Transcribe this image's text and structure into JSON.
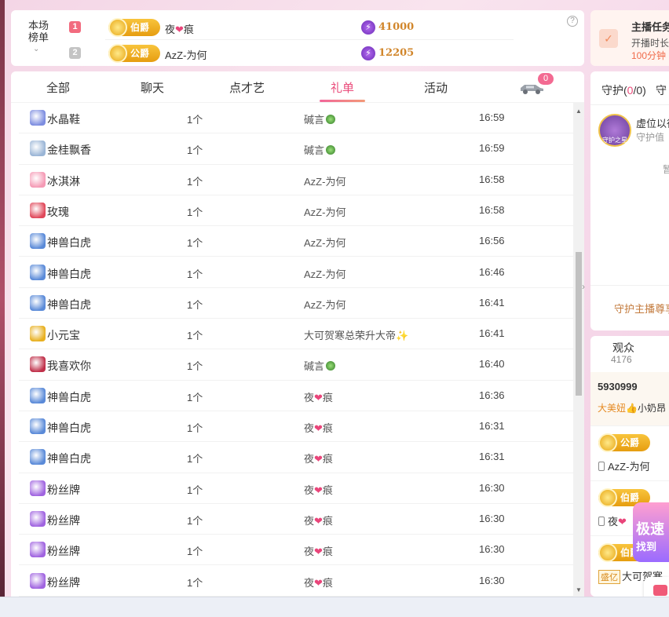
{
  "rank": {
    "title": "本场榜单",
    "help": "?",
    "rows": [
      {
        "num": "1",
        "badge": "伯爵",
        "name_a": "夜",
        "name_b": "痕",
        "value": "41000"
      },
      {
        "num": "2",
        "badge": "公爵",
        "name_a": "AzZ-为何",
        "name_b": "",
        "value": "12205"
      }
    ]
  },
  "task": {
    "title": "主播任务",
    "sub": "开播时长",
    "sub2": "100分钟"
  },
  "tabs": {
    "all": "全部",
    "chat": "聊天",
    "talent": "点才艺",
    "gifts": "礼单",
    "events": "活动",
    "car_badge": "0"
  },
  "gifts": [
    {
      "name": "水晶鞋",
      "qty": "1个",
      "from": "碱言",
      "time": "16:59",
      "icon_color": "#7d8de0",
      "deco": "melon"
    },
    {
      "name": "金桂飘香",
      "qty": "1个",
      "from": "碱言",
      "time": "16:59",
      "icon_color": "#9ab5d6",
      "deco": "melon"
    },
    {
      "name": "冰淇淋",
      "qty": "1个",
      "from": "AzZ-为何",
      "time": "16:58",
      "icon_color": "#f59ab5",
      "deco": ""
    },
    {
      "name": "玫瑰",
      "qty": "1个",
      "from": "AzZ-为何",
      "time": "16:58",
      "icon_color": "#e0485a",
      "deco": ""
    },
    {
      "name": "神兽白虎",
      "qty": "1个",
      "from": "AzZ-为何",
      "time": "16:56",
      "icon_color": "#5a8ad8",
      "deco": ""
    },
    {
      "name": "神兽白虎",
      "qty": "1个",
      "from": "AzZ-为何",
      "time": "16:46",
      "icon_color": "#5a8ad8",
      "deco": ""
    },
    {
      "name": "神兽白虎",
      "qty": "1个",
      "from": "AzZ-为何",
      "time": "16:41",
      "icon_color": "#5a8ad8",
      "deco": ""
    },
    {
      "name": "小元宝",
      "qty": "1个",
      "from": "大可贺寒总荣升大帝",
      "time": "16:41",
      "icon_color": "#e8b020",
      "deco": "sparkle"
    },
    {
      "name": "我喜欢你",
      "qty": "1个",
      "from": "碱言",
      "time": "16:40",
      "icon_color": "#c0304a",
      "deco": "melon"
    },
    {
      "name": "神兽白虎",
      "qty": "1个",
      "from": "夜",
      "time": "16:36",
      "icon_color": "#5a8ad8",
      "deco": "heart"
    },
    {
      "name": "神兽白虎",
      "qty": "1个",
      "from": "夜",
      "time": "16:31",
      "icon_color": "#5a8ad8",
      "deco": "heart"
    },
    {
      "name": "神兽白虎",
      "qty": "1个",
      "from": "夜",
      "time": "16:31",
      "icon_color": "#5a8ad8",
      "deco": "heart"
    },
    {
      "name": "粉丝牌",
      "qty": "1个",
      "from": "夜",
      "time": "16:30",
      "icon_color": "#a064e0",
      "deco": "heart"
    },
    {
      "name": "粉丝牌",
      "qty": "1个",
      "from": "夜",
      "time": "16:30",
      "icon_color": "#a064e0",
      "deco": "heart"
    },
    {
      "name": "粉丝牌",
      "qty": "1个",
      "from": "夜",
      "time": "16:30",
      "icon_color": "#a064e0",
      "deco": "heart"
    },
    {
      "name": "粉丝牌",
      "qty": "1个",
      "from": "夜",
      "time": "16:30",
      "icon_color": "#a064e0",
      "deco": "heart"
    }
  ],
  "gift_suffix": {
    "heart": "痕"
  },
  "guard": {
    "tab1_label": "守护(",
    "tab1_count": "0",
    "tab1_total": "/0)",
    "tab2_label": "守",
    "badge_text": "守护之星",
    "text1": "虚位以待",
    "text2": "守护值",
    "mid": "暂",
    "cta": "守护主播尊享"
  },
  "audience": {
    "title": "观众",
    "count": "4176",
    "top_user_id": "5930999",
    "top_user_tag": "大美妞",
    "top_user_tag2": "小奶昂",
    "items": [
      {
        "badge": "公爵",
        "name": "AzZ-为何",
        "prefix": "phone"
      },
      {
        "badge": "伯爵",
        "name": "夜",
        "prefix": "phone"
      },
      {
        "badge": "伯爵",
        "name": "大可贺寒",
        "prefix": "sheng",
        "sheng": "盛亿"
      }
    ]
  },
  "promo": {
    "line1": "极速",
    "line2": "找到"
  },
  "colors": {
    "accent": "#ea4b7a",
    "gold": "#d1862b"
  }
}
